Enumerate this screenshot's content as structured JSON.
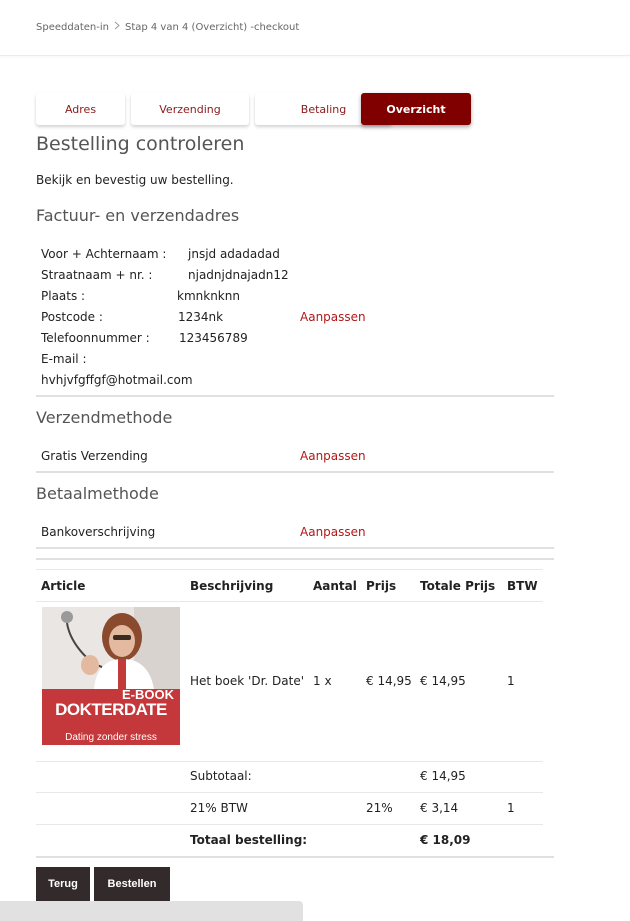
{
  "breadcrumb": {
    "root": "Speeddaten-in",
    "current": "Stap 4 van 4 (Overzicht) -checkout"
  },
  "steps": [
    {
      "label": "Adres"
    },
    {
      "label": "Verzending"
    },
    {
      "label": "Betaling"
    },
    {
      "label": "Overzicht"
    }
  ],
  "page_title": "Bestelling controleren",
  "intro": "Bekijk en bevestig uw bestelling.",
  "address": {
    "heading": "Factuur- en verzendadres",
    "name_label": "Voor + Achternaam :",
    "name_value": "jnsjd adadadad",
    "street_label": "Straatnaam + nr. :",
    "street_value": "njadnjdnajadn12",
    "city_label": "Plaats :",
    "city_value": "kmnknknn",
    "postcode_label": "Postcode :",
    "postcode_value": "1234nk",
    "phone_label": "Telefoonnummer :",
    "phone_value": "123456789",
    "email_label": "E-mail :",
    "email_value": "hvhjvfgffgf@hotmail.com",
    "edit_label": "Aanpassen"
  },
  "shipping": {
    "heading": "Verzendmethode",
    "value": "Gratis Verzending",
    "edit_label": "Aanpassen"
  },
  "payment": {
    "heading": "Betaalmethode",
    "value": "Bankoverschrijving",
    "edit_label": "Aanpassen"
  },
  "table": {
    "headers": [
      "Article",
      "Beschrijving",
      "Aantal",
      "Prijs",
      "Totale Prijs",
      "BTW"
    ],
    "item": {
      "description": "Het boek 'Dr. Date'",
      "quantity": "1 x",
      "price": "€ 14,95",
      "total": "€ 14,95",
      "btw": "1",
      "image_text": {
        "line1": "E-BOOK",
        "line2": "DOKTERDATE",
        "line3": "Dating zonder stress"
      }
    },
    "subtotal_label": "Subtotaal:",
    "subtotal_value": "€ 14,95",
    "vat_label": "21% BTW",
    "vat_rate": "21%",
    "vat_value": "€ 3,14",
    "vat_btw": "1",
    "total_label": "Totaal bestelling:",
    "total_value": "€ 18,09"
  },
  "buttons": {
    "back": "Terug",
    "order": "Bestellen"
  },
  "colors": {
    "accent": "#800000",
    "link": "#b01818",
    "button": "#332b2b"
  }
}
